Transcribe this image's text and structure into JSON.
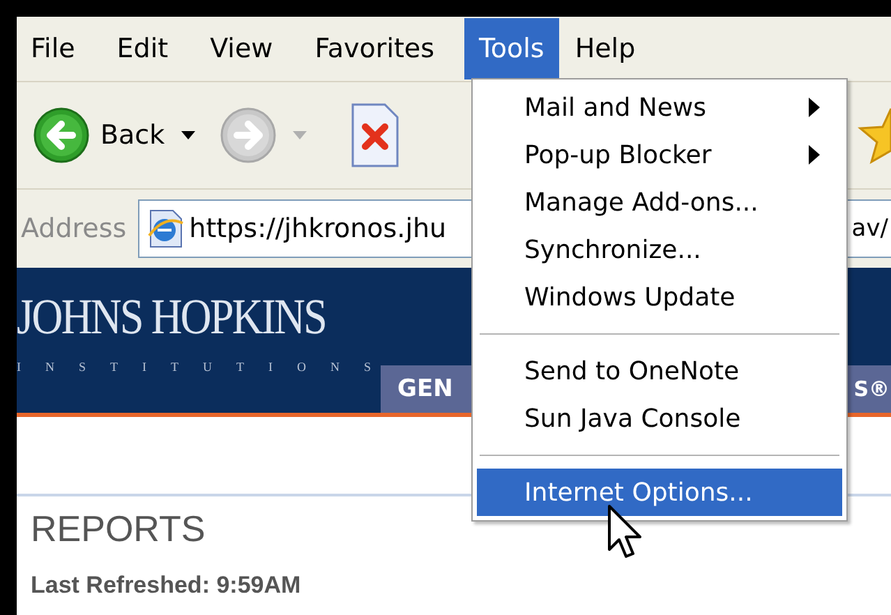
{
  "menu_bar": [
    {
      "label": "File",
      "selected": false
    },
    {
      "label": "Edit",
      "selected": false
    },
    {
      "label": "View",
      "selected": false
    },
    {
      "label": "Favorites",
      "selected": false
    },
    {
      "label": "Tools",
      "selected": true
    },
    {
      "label": "Help",
      "selected": false
    }
  ],
  "toolbar": [
    {
      "kind": "back",
      "label": "Back",
      "disabled": false
    },
    {
      "kind": "forward",
      "disabled": true
    },
    {
      "kind": "stop"
    },
    {
      "kind": "favorites"
    }
  ],
  "address_bar": {
    "label": "Address",
    "url_start": "https://jhkronos.jhu",
    "url_end": "av/"
  },
  "banner": {
    "logo_title": "JOHNS HOPKINS",
    "logo_subtitle": "INSTITUTIONS",
    "tabs": [
      "GEN",
      "S®"
    ]
  },
  "content": {
    "heading": "REPORTS",
    "refreshed": "Last Refreshed: 9:59AM"
  },
  "tools_menu": [
    {
      "kind": "item",
      "label": "Mail and News",
      "submenu": true,
      "selected": false
    },
    {
      "kind": "item",
      "label": "Pop-up Blocker",
      "submenu": true,
      "selected": false
    },
    {
      "kind": "item",
      "label": "Manage Add-ons...",
      "submenu": false,
      "selected": false
    },
    {
      "kind": "item",
      "label": "Synchronize...",
      "submenu": false,
      "selected": false
    },
    {
      "kind": "item",
      "label": "Windows Update",
      "submenu": false,
      "selected": false
    },
    {
      "kind": "separator"
    },
    {
      "kind": "item",
      "label": "Send to OneNote",
      "submenu": false,
      "selected": false
    },
    {
      "kind": "item",
      "label": "Sun Java Console",
      "submenu": false,
      "selected": false
    },
    {
      "kind": "separator"
    },
    {
      "kind": "item",
      "label": "Internet Options...",
      "submenu": false,
      "selected": true
    }
  ]
}
